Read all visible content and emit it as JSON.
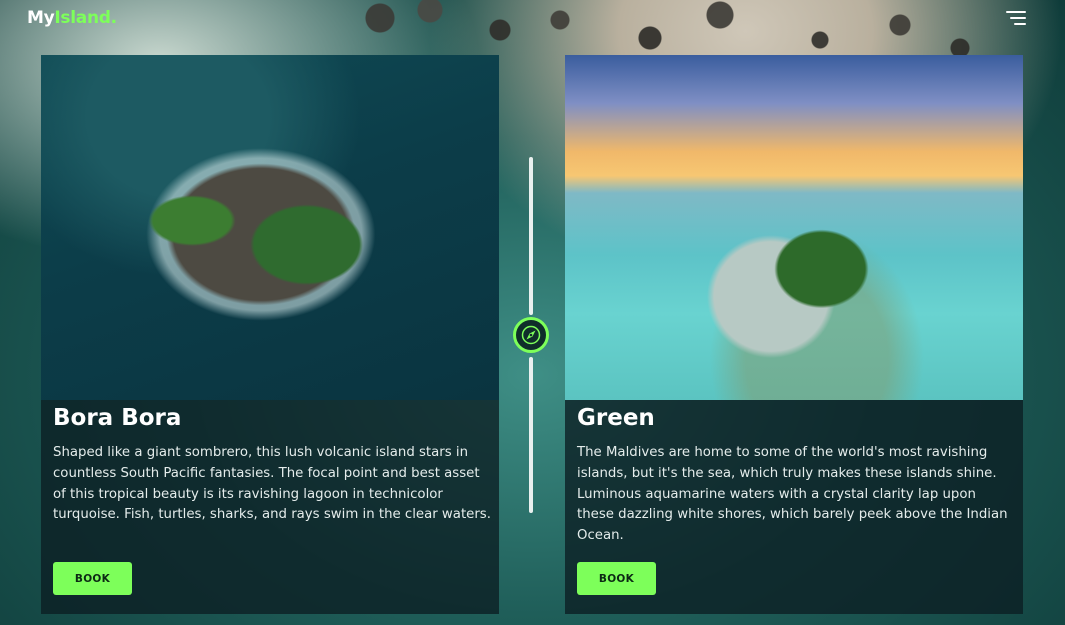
{
  "header": {
    "logo_prefix": "My",
    "logo_accent": "Island",
    "logo_suffix": ".",
    "menu_icon": "hamburger-menu-icon"
  },
  "cards": [
    {
      "title": "Bora Bora",
      "description": "Shaped like a giant sombrero, this lush volcanic island stars in countless South Pacific fantasies. The focal point and best asset of this tropical beauty is its ravishing lagoon in technicolor turquoise. Fish, turtles, sharks, and rays swim in the clear waters.",
      "button_label": "BOOK"
    },
    {
      "title": "Green",
      "description": "The Maldives are home to some of the world's most ravishing islands, but it's the sea, which truly makes these islands shine. Luminous aquamarine waters with a crystal clarity lap upon these dazzling white shores, which barely peek above the Indian Ocean.",
      "button_label": "BOOK"
    }
  ],
  "center_icon": "compass-icon",
  "colors": {
    "accent": "#7dff5a",
    "card_bg": "#0c1e22",
    "text": "#ffffff"
  }
}
